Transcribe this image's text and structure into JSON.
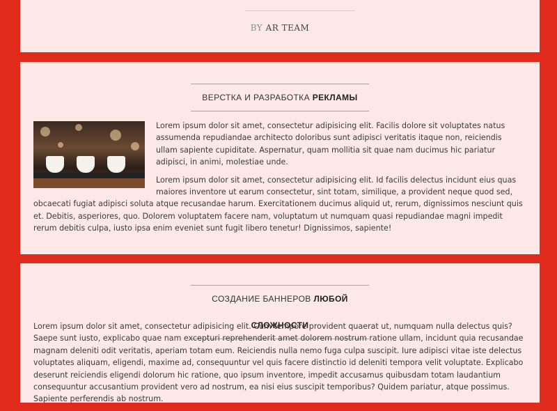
{
  "top_card": {
    "author_prefix": "BY",
    "author_name": "AR TEAM"
  },
  "sections": [
    {
      "heading_normal": "ВЕРСТКА И РАЗРАБОТКА",
      "heading_bold": "РЕКЛАМЫ",
      "image_icon": "coffee-cups-photo",
      "paragraphs": [
        "Lorem ipsum dolor sit amet, consectetur adipisicing elit. Facilis dolore sit voluptates natus assumenda repudiandae architecto doloribus sunt adipisci veritatis itaque non, reiciendis ullam sapiente cupiditate. Aspernatur, quam mollitia sit quae nam ducimus hic pariatur adipisci, in animi, molestiae unde.",
        "Lorem ipsum dolor sit amet, consectetur adipisicing elit. Id facilis delectus incidunt eius quas maiores inventore ut earum consectetur, sint totam, similique, a provident neque quod sed, obcaecati fugiat adipisci soluta atque recusandae harum. Exercitationem ducimus aliquid ut, rerum, dignissimos nesciunt quis et. Debitis, asperiores, quo. Dolorem voluptatem facere nam, voluptatum ut numquam quasi repudiandae magni impedit rerum debitis culpa, iusto ipsa enim eveniet sunt fugit libero tenetur! Dignissimos, sapiente!"
      ]
    },
    {
      "heading_normal": "СОЗДАНИЕ БАННЕРОВ",
      "heading_bold": "ЛЮБОЙ СЛОЖНОСТИ",
      "paragraphs": [
        "Lorem ipsum dolor sit amet, consectetur adipisicing elit. Cum tempore provident quaerat ut, numquam nulla delectus quis? Saepe sunt iusto, explicabo quae nam excepturi reprehenderit amet dolorem nostrum ratione ullam, incidunt quia recusandae magnam deleniti odit veritatis, aperiam totam eum. Reiciendis nulla nemo fuga culpa suscipit. Iure adipisci vitae iste delectus voluptates aliquam, eligendi, maxime ad, consequuntur vel quis facere distinctio id deleniti tempora velit voluptate. Explicabo deserunt reiciendis eligendi dolorum hic ratione, quo ipsum inventore, impedit accusamus quibusdam totam laudantium consequuntur accusantium provident vero ad nostrum, ea nisi eius suscipit temporibus? Quidem pariatur, atque possimus. Sapiente perferendis ab nostrum."
      ]
    }
  ],
  "colors": {
    "page_background": "#df2a1c",
    "card_background": "#fbe8e7"
  }
}
